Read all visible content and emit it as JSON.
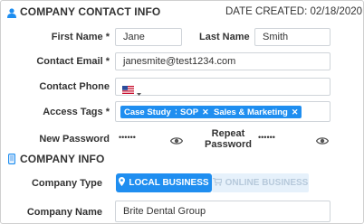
{
  "contact_section": {
    "title": "COMPANY CONTACT INFO",
    "date_created": "DATE CREATED: 02/18/2020",
    "first_name_label": "First Name *",
    "first_name_value": "Jane",
    "last_name_label": "Last Name",
    "last_name_value": "Smith",
    "email_label": "Contact Email *",
    "email_value": "janesmite@test1234.com",
    "phone_label": "Contact Phone",
    "phone_country": "US",
    "access_tags_label": "Access Tags *",
    "tags": [
      "Case Study",
      "SOP",
      "Sales & Marketing"
    ],
    "new_password_label": "New Password",
    "new_password_value": "••••••",
    "repeat_password_label_line1": "Repeat",
    "repeat_password_label_line2": "Password",
    "repeat_password_value": "••••••",
    "icon": "user-icon"
  },
  "company_section": {
    "title": "COMPANY INFO",
    "icon": "tablet-icon",
    "type_label": "Company Type",
    "type_options": [
      "LOCAL BUSINESS",
      "ONLINE BUSINESS"
    ],
    "type_selected": "LOCAL BUSINESS",
    "name_label": "Company Name",
    "name_value": "Brite Dental Group"
  },
  "colors": {
    "accent": "#1f8ef0",
    "inactive_bg": "#e6f1fb",
    "inactive_text": "#b6c9db"
  }
}
